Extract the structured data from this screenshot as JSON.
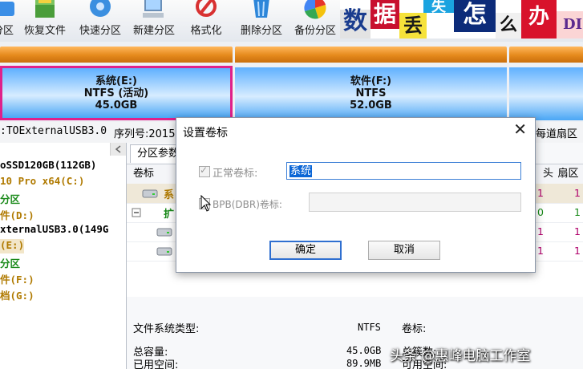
{
  "toolbar": {
    "items": [
      {
        "label": "分区",
        "icon": "partition-icon"
      },
      {
        "label": "恢复文件",
        "icon": "recover-file-icon"
      },
      {
        "label": "快速分区",
        "icon": "quick-partition-icon"
      },
      {
        "label": "新建分区",
        "icon": "new-partition-icon"
      },
      {
        "label": "格式化",
        "icon": "format-icon"
      },
      {
        "label": "删除分区",
        "icon": "delete-partition-icon"
      },
      {
        "label": "备份分区",
        "icon": "backup-partition-icon"
      }
    ],
    "banner_chars": [
      "数",
      "据",
      "丢",
      "失",
      "怎",
      "么",
      "办",
      "DI"
    ]
  },
  "partitions": [
    {
      "name": "系统(E:)",
      "fs": "NTFS (活动)",
      "size": "45.0GB"
    },
    {
      "name": "软件(F:)",
      "fs": "NTFS",
      "size": "52.0GB"
    }
  ],
  "disk_info": {
    "model": ":TOExternalUSB3.0",
    "serial_label": "序列号:2015",
    "track_label": "每道扇区"
  },
  "tree": [
    {
      "text": "oSSD120GB(112GB)",
      "color": "#000000"
    },
    {
      "text": "10 Pro x64(C:)",
      "color": "#b07a00"
    },
    {
      "text": "分区",
      "color": "#1a8a1a"
    },
    {
      "text": "件(D:)",
      "color": "#b07a00"
    },
    {
      "text": "xternalUSB3.0(149G",
      "color": "#000000"
    },
    {
      "text": "(E:)",
      "color": "#b07a00"
    },
    {
      "text": "分区",
      "color": "#1a8a1a"
    },
    {
      "text": "件(F:)",
      "color": "#b07a00"
    },
    {
      "text": "档(G:)",
      "color": "#b07a00"
    }
  ],
  "right_panel": {
    "tab_label": "分区参数",
    "col_label": "卷标",
    "col_head": "头",
    "col_sector": "扇区",
    "rows": [
      {
        "name": "系",
        "head": "1",
        "sector": "1",
        "color": "#b07a00"
      },
      {
        "name": "扩",
        "head": "0",
        "sector": "1",
        "color": "#1a8a1a"
      },
      {
        "name": "",
        "head": "1",
        "sector": "1",
        "color": "#000000"
      },
      {
        "name": "",
        "head": "1",
        "sector": "1",
        "color": "#000000"
      }
    ],
    "details": {
      "fs_type_label": "文件系统类型:",
      "fs_type_value": "NTFS",
      "volume_label": "卷标:",
      "total_label": "总容量:",
      "total_value": "45.0GB",
      "used_label": "已用空间:",
      "used_value": "89.9MB",
      "total_clusters_label": "总簇数:",
      "free_label": "可用空间:"
    }
  },
  "dialog": {
    "title": "设置卷标",
    "normal_label": "正常卷标:",
    "normal_value": "系统",
    "bpb_label": "BPB(DBR)卷标:",
    "bpb_value": "",
    "ok_label": "确定",
    "cancel_label": "取消",
    "close_glyph": "✕"
  },
  "watermark": "头条 @惠峰电脑工作室",
  "colors": {
    "accent_blue": "#0b66d6",
    "active_partition_border": "#e0218a",
    "partition_cap": "#e58a1c"
  }
}
